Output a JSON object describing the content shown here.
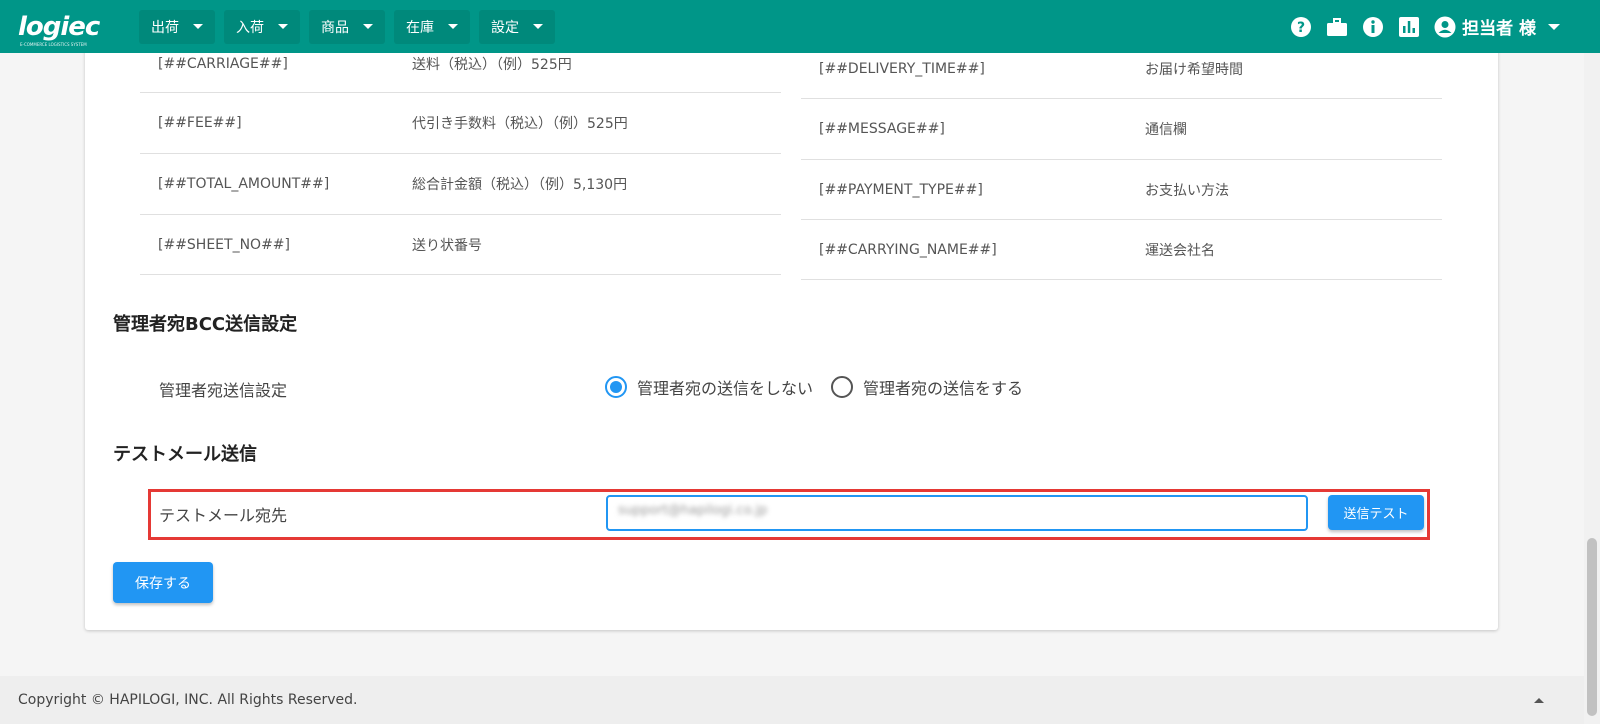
{
  "app": {
    "logo_text": "logiec",
    "logo_tagline": "E-COMMERCE LOGISTICS SYSTEM"
  },
  "nav": [
    {
      "label": "出荷"
    },
    {
      "label": "入荷"
    },
    {
      "label": "商品"
    },
    {
      "label": "在庫"
    },
    {
      "label": "設定"
    }
  ],
  "header_right": {
    "icons": [
      "help-icon",
      "briefcase-icon",
      "info-icon",
      "chart-icon",
      "account-icon"
    ],
    "user_label": "担当者 様"
  },
  "placeholder_table_left": [
    {
      "key": "[##CARRIAGE##]",
      "desc": "送料（税込）（例）525円"
    },
    {
      "key": "[##FEE##]",
      "desc": "代引き手数料（税込）（例）525円"
    },
    {
      "key": "[##TOTAL_AMOUNT##]",
      "desc": "総合計金額（税込）（例）5,130円"
    },
    {
      "key": "[##SHEET_NO##]",
      "desc": "送り状番号"
    }
  ],
  "placeholder_table_right": [
    {
      "key": "[##DELIVERY_TIME##]",
      "desc": "お届け希望時間"
    },
    {
      "key": "[##MESSAGE##]",
      "desc": "通信欄"
    },
    {
      "key": "[##PAYMENT_TYPE##]",
      "desc": "お支払い方法"
    },
    {
      "key": "[##CARRYING_NAME##]",
      "desc": "運送会社名"
    }
  ],
  "bcc_section": {
    "title": "管理者宛BCC送信設定",
    "field_label": "管理者宛送信設定",
    "options": [
      {
        "label": "管理者宛の送信をしない",
        "checked": true
      },
      {
        "label": "管理者宛の送信をする",
        "checked": false
      }
    ]
  },
  "test_mail_section": {
    "title": "テストメール送信",
    "field_label": "テストメール宛先",
    "email_value": "support@hapilogi.co.jp",
    "send_button": "送信テスト"
  },
  "save_button": "保存する",
  "footer": {
    "copyright": "Copyright © HAPILOGI, INC. All Rights Reserved."
  },
  "colors": {
    "header": "#009688",
    "primary": "#2196f3",
    "highlight": "#e53935"
  }
}
